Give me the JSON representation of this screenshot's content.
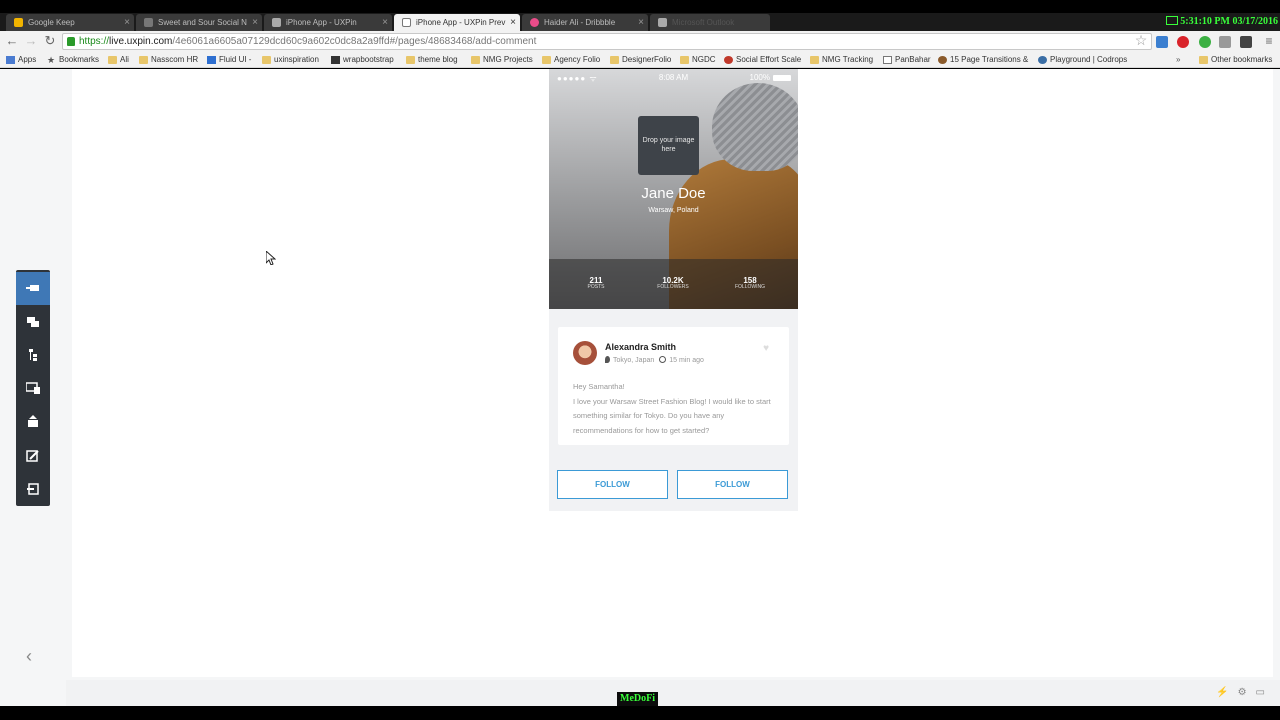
{
  "browser": {
    "tabs": [
      {
        "label": "Google Keep",
        "color": "#f2b400"
      },
      {
        "label": "Sweet and Sour Social N",
        "color": "#777777"
      },
      {
        "label": "iPhone App - UXPin",
        "color": "#aaaaaa"
      },
      {
        "label": "iPhone App - UXPin Prev",
        "color": "#aaaaaa",
        "active": true
      },
      {
        "label": "Haider Ali - Dribbble",
        "color": "#ea4c89"
      },
      {
        "label": "Microsoft Outlook",
        "color": "#aaaaaa"
      }
    ],
    "url_scheme": "https://",
    "url_host": "live.uxpin.com",
    "url_path": "/4e6061a6605a07129dcd60c9a602c0dc8a2a9ffd#/pages/48683468/add-comment",
    "clock": "5:31:10 PM 03/17/2016",
    "bookmarks": [
      "Apps",
      "Bookmarks",
      "Ali",
      "Nasscom HR",
      "Fluid UI -",
      "uxinspiration",
      "wrapbootstrap",
      "theme blog",
      "NMG Projects",
      "Agency Folio",
      "DesignerFolio",
      "NGDC",
      "Social Effort Scale",
      "NMG Tracking",
      "PanBahar",
      "15 Page Transitions &",
      "Playground | Codrops"
    ],
    "other_bookmarks": "Other bookmarks"
  },
  "preview": {
    "sidebar_icons": [
      "comments-toggle-icon",
      "pages-icon",
      "sitemap-icon",
      "devices-icon",
      "share-icon",
      "edit-icon",
      "exit-icon"
    ]
  },
  "phone": {
    "status": {
      "signal": "●●●●● ᯤ",
      "time": "8:08 AM",
      "battery": "100%"
    },
    "dropzone": "Drop your image here",
    "name": "Jane Doe",
    "location": "Warsaw, Poland",
    "stats": [
      {
        "value": "211",
        "label": "POSTS"
      },
      {
        "value": "10.2K",
        "label": "FOLLOWERS"
      },
      {
        "value": "158",
        "label": "FOLLOWING"
      }
    ],
    "card": {
      "author": "Alexandra Smith",
      "place": "Tokyo, Japan",
      "time": "15 min ago",
      "line1": "Hey Samantha!",
      "line2": "I love your Warsaw Street Fashion Blog! I would like to start something similar for Tokyo. Do you have any recommendations for how to get started?"
    },
    "follow_left": "FOLLOW",
    "follow_right": "FOLLOW"
  },
  "watermark": "MeDoFi"
}
